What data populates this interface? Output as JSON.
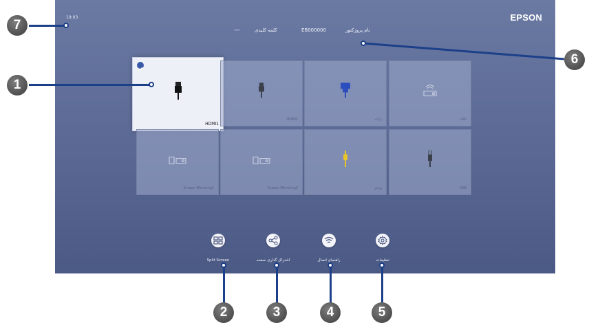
{
  "status": {
    "time": "19:03"
  },
  "brand": "EPSON",
  "header": {
    "projector_name_label": "نام پروژکتور",
    "projector_name": "EB000000",
    "keyword_label": "کلمه کلیدی",
    "keyword_value": "-----"
  },
  "sources": [
    {
      "label": "HDMI1",
      "selected": true,
      "icon": "hdmi-plug-icon"
    },
    {
      "label": "HDMI2",
      "selected": false,
      "icon": "hdmi-plug-icon"
    },
    {
      "label": "رایانه",
      "selected": false,
      "icon": "vga-plug-icon"
    },
    {
      "label": "LAN",
      "selected": false,
      "icon": "lan-projector-icon"
    },
    {
      "label": "Screen Mirroring1",
      "selected": false,
      "icon": "screen-mirroring-icon"
    },
    {
      "label": "Screen Mirroring2",
      "selected": false,
      "icon": "screen-mirroring-icon"
    },
    {
      "label": "ویدئو",
      "selected": false,
      "icon": "rca-plug-icon"
    },
    {
      "label": "USB",
      "selected": false,
      "icon": "usb-plug-icon"
    }
  ],
  "toolbar": {
    "split_screen": "Split Screen",
    "share_screen": "اشتراک گذاری صفحه",
    "connection_guide": "راهنمای اتصال",
    "settings": "تنظیمات"
  },
  "callouts": [
    "1",
    "2",
    "3",
    "4",
    "5",
    "6",
    "7"
  ],
  "colors": {
    "accent": "#1b3f88",
    "screen": "#5a6893",
    "check": "#3a5aa8"
  }
}
